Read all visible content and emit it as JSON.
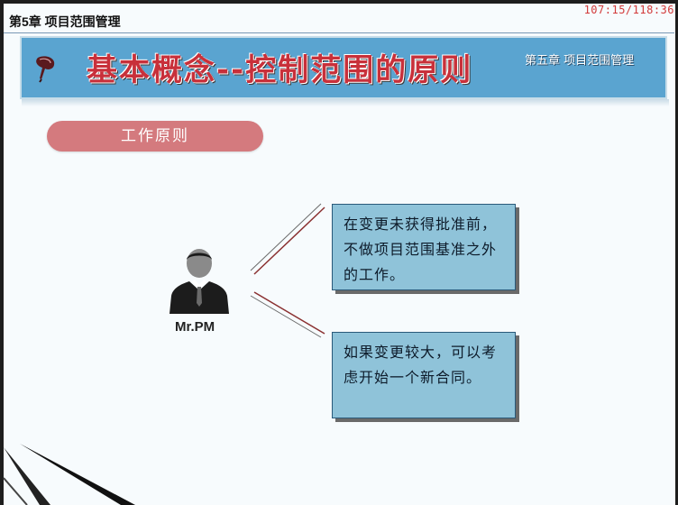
{
  "header": {
    "chapter_label": "第5章 项目范围管理",
    "timer": "107:15/118:36"
  },
  "banner": {
    "title": "基本概念--控制范围的原则",
    "subtitle": "第五章 项目范围管理",
    "icon": "quill-pen-icon"
  },
  "section": {
    "pill_label": "工作原则"
  },
  "person": {
    "icon": "businessman-avatar-icon",
    "name": "Mr.PM"
  },
  "principles": [
    {
      "text": "在变更未获得批准前，不做项目范围基准之外的工作。"
    },
    {
      "text": "如果变更较大，可以考虑开始一个新合同。"
    }
  ],
  "colors": {
    "banner": "#5aa4d0",
    "title_red": "#c8303a",
    "pill": "#d47a7e",
    "box_fill": "#8fc3d9"
  }
}
